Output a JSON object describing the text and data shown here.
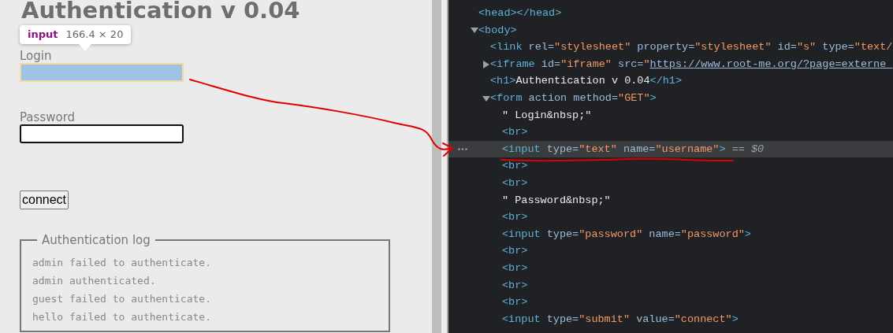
{
  "page": {
    "heading": "Authentication v 0.04",
    "tooltip": {
      "tag": "input",
      "size": "166.4 × 20"
    },
    "fields": [
      {
        "label": "Login",
        "highlighted": true
      },
      {
        "label": "Password",
        "highlighted": false
      }
    ],
    "button": "connect",
    "log": {
      "legend": "Authentication log",
      "lines": [
        "admin failed to authenticate.",
        "admin authenticated.",
        "guest failed to authenticate.",
        "hello failed to authenticate."
      ]
    }
  },
  "devtools": {
    "tree": [
      {
        "selected": false,
        "tokens": [
          {
            "kind": "tag",
            "text": "<head></head>"
          }
        ]
      },
      {
        "selected": false,
        "expanded": true,
        "tokens": [
          {
            "kind": "tag",
            "text": "<body>"
          }
        ],
        "children": [
          {
            "selected": false,
            "tokens": [
              {
                "kind": "tag",
                "text": "<link"
              },
              {
                "kind": "attr",
                "text": " rel="
              },
              {
                "kind": "value",
                "text": "\"stylesheet\""
              },
              {
                "kind": "attr",
                "text": " property="
              },
              {
                "kind": "value",
                "text": "\"stylesheet\""
              },
              {
                "kind": "attr",
                "text": " id="
              },
              {
                "kind": "value",
                "text": "\"s\""
              },
              {
                "kind": "attr",
                "text": " type="
              },
              {
                "kind": "value",
                "text": "\"text/"
              }
            ]
          },
          {
            "selected": false,
            "expanded": false,
            "tokens": [
              {
                "kind": "tag",
                "text": "<iframe"
              },
              {
                "kind": "attr",
                "text": " id="
              },
              {
                "kind": "value",
                "text": "\"iframe\""
              },
              {
                "kind": "attr",
                "text": " src="
              },
              {
                "kind": "value",
                "text": "\""
              },
              {
                "kind": "link",
                "text": "https://www.root-me.org/?page=externe_"
              }
            ]
          },
          {
            "selected": false,
            "tokens": [
              {
                "kind": "tag",
                "text": "<h1>"
              },
              {
                "kind": "text",
                "text": "Authentication v 0.04"
              },
              {
                "kind": "tag",
                "text": "</h1>"
              }
            ]
          },
          {
            "selected": false,
            "expanded": true,
            "tokens": [
              {
                "kind": "tag",
                "text": "<form"
              },
              {
                "kind": "attr",
                "text": " action method="
              },
              {
                "kind": "value",
                "text": "\"GET\""
              },
              {
                "kind": "tag",
                "text": ">"
              }
            ],
            "children": [
              {
                "selected": false,
                "tokens": [
                  {
                    "kind": "text",
                    "text": "\" Login&nbsp;\""
                  }
                ]
              },
              {
                "selected": false,
                "tokens": [
                  {
                    "kind": "tag",
                    "text": "<br>"
                  }
                ]
              },
              {
                "selected": true,
                "tokens": [
                  {
                    "kind": "tag",
                    "text": "<input"
                  },
                  {
                    "kind": "attr",
                    "text": " type="
                  },
                  {
                    "kind": "value",
                    "text": "\"text\""
                  },
                  {
                    "kind": "attr",
                    "text": " name="
                  },
                  {
                    "kind": "value",
                    "text": "\"username\""
                  },
                  {
                    "kind": "tag",
                    "text": ">"
                  },
                  {
                    "kind": "ref",
                    "text": " == $0"
                  }
                ]
              },
              {
                "selected": false,
                "tokens": [
                  {
                    "kind": "tag",
                    "text": "<br>"
                  }
                ]
              },
              {
                "selected": false,
                "tokens": [
                  {
                    "kind": "tag",
                    "text": "<br>"
                  }
                ]
              },
              {
                "selected": false,
                "tokens": [
                  {
                    "kind": "text",
                    "text": "\" Password&nbsp;\""
                  }
                ]
              },
              {
                "selected": false,
                "tokens": [
                  {
                    "kind": "tag",
                    "text": "<br>"
                  }
                ]
              },
              {
                "selected": false,
                "tokens": [
                  {
                    "kind": "tag",
                    "text": "<input"
                  },
                  {
                    "kind": "attr",
                    "text": " type="
                  },
                  {
                    "kind": "value",
                    "text": "\"password\""
                  },
                  {
                    "kind": "attr",
                    "text": " name="
                  },
                  {
                    "kind": "value",
                    "text": "\"password\""
                  },
                  {
                    "kind": "tag",
                    "text": ">"
                  }
                ]
              },
              {
                "selected": false,
                "tokens": [
                  {
                    "kind": "tag",
                    "text": "<br>"
                  }
                ]
              },
              {
                "selected": false,
                "tokens": [
                  {
                    "kind": "tag",
                    "text": "<br>"
                  }
                ]
              },
              {
                "selected": false,
                "tokens": [
                  {
                    "kind": "tag",
                    "text": "<br>"
                  }
                ]
              },
              {
                "selected": false,
                "tokens": [
                  {
                    "kind": "tag",
                    "text": "<br>"
                  }
                ]
              },
              {
                "selected": false,
                "tokens": [
                  {
                    "kind": "tag",
                    "text": "<input"
                  },
                  {
                    "kind": "attr",
                    "text": " type="
                  },
                  {
                    "kind": "value",
                    "text": "\"submit\""
                  },
                  {
                    "kind": "attr",
                    "text": " value="
                  },
                  {
                    "kind": "value",
                    "text": "\"connect\""
                  },
                  {
                    "kind": "tag",
                    "text": ">"
                  }
                ]
              }
            ]
          }
        ]
      }
    ]
  }
}
